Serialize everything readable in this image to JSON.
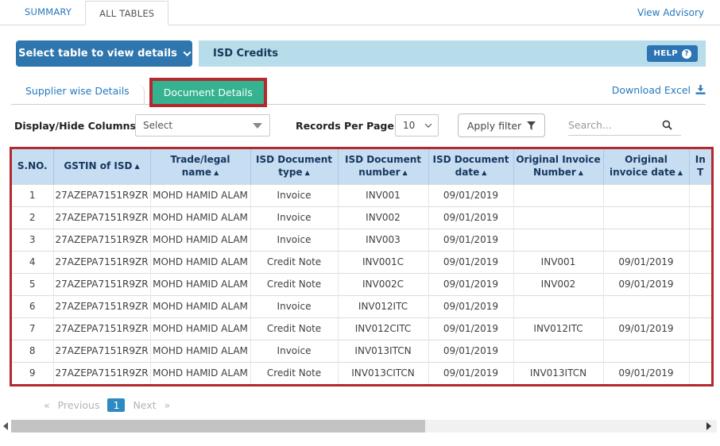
{
  "header_tabs": {
    "summary": "SUMMARY",
    "all_tables": "ALL TABLES",
    "view_advisory": "View Advisory"
  },
  "toolbar": {
    "select_table_button": "Select table to view details",
    "section_title": "ISD Credits",
    "help_label": "HELP",
    "help_icon_glyph": "?"
  },
  "subtabs": {
    "supplier": "Supplier wise Details",
    "document": "Document Details",
    "download_excel": "Download Excel"
  },
  "controls": {
    "display_hide_label": "Display/Hide Columns:",
    "column_select_value": "Select",
    "records_per_page_label": "Records Per Page:",
    "records_per_page_value": "10",
    "apply_filter_label": "Apply filter",
    "search_placeholder": "Search..."
  },
  "table": {
    "headers": [
      {
        "label": "S.NO.",
        "sortable": false
      },
      {
        "label": "GSTIN of ISD",
        "sortable": true
      },
      {
        "label": "Trade/legal name",
        "sortable": true
      },
      {
        "label": "ISD Document type",
        "sortable": true
      },
      {
        "label": "ISD Document number",
        "sortable": true
      },
      {
        "label": "ISD Document date",
        "sortable": true
      },
      {
        "label": "Original Invoice Number",
        "sortable": true
      },
      {
        "label": "Original invoice date",
        "sortable": true
      },
      {
        "label": "In\nT",
        "sortable": false,
        "clipped": true
      }
    ],
    "rows": [
      [
        "1",
        "27AZEPA7151R9ZR",
        "MOHD HAMID ALAM",
        "Invoice",
        "INV001",
        "09/01/2019",
        "",
        "",
        ""
      ],
      [
        "2",
        "27AZEPA7151R9ZR",
        "MOHD HAMID ALAM",
        "Invoice",
        "INV002",
        "09/01/2019",
        "",
        "",
        ""
      ],
      [
        "3",
        "27AZEPA7151R9ZR",
        "MOHD HAMID ALAM",
        "Invoice",
        "INV003",
        "09/01/2019",
        "",
        "",
        ""
      ],
      [
        "4",
        "27AZEPA7151R9ZR",
        "MOHD HAMID ALAM",
        "Credit Note",
        "INV001C",
        "09/01/2019",
        "INV001",
        "09/01/2019",
        ""
      ],
      [
        "5",
        "27AZEPA7151R9ZR",
        "MOHD HAMID ALAM",
        "Credit Note",
        "INV002C",
        "09/01/2019",
        "INV002",
        "09/01/2019",
        ""
      ],
      [
        "6",
        "27AZEPA7151R9ZR",
        "MOHD HAMID ALAM",
        "Invoice",
        "INV012ITC",
        "09/01/2019",
        "",
        "",
        ""
      ],
      [
        "7",
        "27AZEPA7151R9ZR",
        "MOHD HAMID ALAM",
        "Credit Note",
        "INV012CITC",
        "09/01/2019",
        "INV012ITC",
        "09/01/2019",
        ""
      ],
      [
        "8",
        "27AZEPA7151R9ZR",
        "MOHD HAMID ALAM",
        "Invoice",
        "INV013ITCN",
        "09/01/2019",
        "",
        "",
        ""
      ],
      [
        "9",
        "27AZEPA7151R9ZR",
        "MOHD HAMID ALAM",
        "Credit Note",
        "INV013CITCN",
        "09/01/2019",
        "INV013ITCN",
        "09/01/2019",
        ""
      ]
    ]
  },
  "pagination": {
    "prev_symbol": "«",
    "previous": "Previous",
    "page": "1",
    "next": "Next",
    "next_symbol": "»"
  },
  "icons": {
    "select_table": "chevron-down-icon",
    "help": "question-circle-icon",
    "download": "download-icon",
    "filter": "funnel-icon",
    "search": "magnifier-icon",
    "sort": "sort-asc-icon",
    "scroll_left": "arrow-left-icon",
    "scroll_right": "arrow-right-icon"
  },
  "colors": {
    "accent_blue": "#2e76ad",
    "link_blue": "#2779be",
    "light_blue_bar": "#b6dde9",
    "green_tab": "#35b28f",
    "annotation_red": "#b2292e",
    "table_header_bg": "#c6ddf2",
    "table_header_text": "#17375e",
    "pagination_active_bg": "#2e8ac2"
  }
}
